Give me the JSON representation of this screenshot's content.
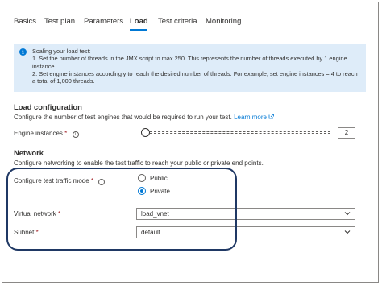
{
  "tabs": [
    {
      "label": "Basics",
      "active": false
    },
    {
      "label": "Test plan",
      "active": false
    },
    {
      "label": "Parameters",
      "active": false
    },
    {
      "label": "Load",
      "active": true
    },
    {
      "label": "Test criteria",
      "active": false
    },
    {
      "label": "Monitoring",
      "active": false
    }
  ],
  "info": {
    "icon": "info-icon",
    "line1": "Scaling your load test:",
    "line2": "1. Set the number of threads in the JMX script to max 250. This represents the number of threads executed by 1 engine instance.",
    "line3": "2. Set engine instances accordingly to reach the desired number of threads. For example, set engine instances = 4 to reach a total of 1,000 threads."
  },
  "load_config": {
    "title": "Load configuration",
    "description": "Configure the number of test engines that would be required to run your test.",
    "learn_more": "Learn more",
    "engine_label": "Engine instances",
    "required_mark": "*",
    "engine_value": "2"
  },
  "network": {
    "title": "Network",
    "description": "Configure networking to enable the test traffic to reach your public or private end points.",
    "mode_label": "Configure test traffic mode",
    "required_mark": "*",
    "options": [
      {
        "label": "Public",
        "selected": false
      },
      {
        "label": "Private",
        "selected": true
      }
    ],
    "vnet_label": "Virtual network",
    "vnet_value": "load_vnet",
    "subnet_label": "Subnet",
    "subnet_value": "default"
  },
  "colors": {
    "accent": "#0078d4",
    "info_bg": "#deecf9",
    "required": "#a4262c",
    "highlight": "#1f3864"
  }
}
